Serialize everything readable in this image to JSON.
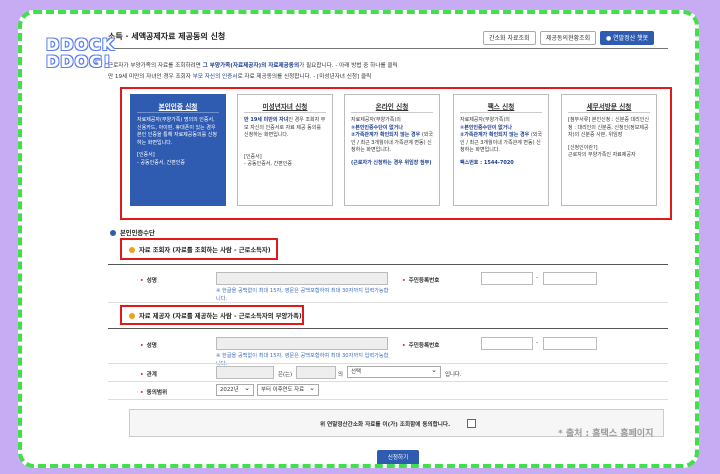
{
  "header": {
    "title": "소득 · 세액공제자료 제공동의 신청",
    "buttons": [
      "간소화 자료조회",
      "제공동의현황조회",
      "연말정산 챗봇"
    ]
  },
  "logo": {
    "line1": "DDOCK",
    "line2": "DDOG!"
  },
  "desc": {
    "line1_a": "근로자가 부양가족의 자료를 조회하려면 ",
    "line1_b": "그 부양가족(자료제공자)의 자료제공동의",
    "line1_c": "가 필요합니다. - 아래 방법 중 하나를 클릭",
    "line2_a": "만 19세 미만의 자녀인 경우 조회자 ",
    "line2_b": "부모 자신의 인증서",
    "line2_c": "로 자료 제공동의를 신청합니다. - [미성년자녀 신청] 클릭"
  },
  "cards": [
    {
      "title": "본인인증 신청",
      "body": "자료제공자(부양가족) 명의의 인증서, 신용카드, 아이핀, 휴대폰이 있는 경우 본인 인증을 통해 자료제공동의를 신청하는 화면입니다.",
      "tag": "[인증서]",
      "tag2": "- 공동인증서, 간편인증"
    },
    {
      "title": "미성년자녀 신청",
      "body_em": "만 19세 미만의 자녀",
      "body": "인 경우 조회자 부모 자신의 인증서로 자료 제공 동의를 신청하는 화면입니다.",
      "tag": "[인증서]",
      "tag2": "- 공동인증서, 간편인증"
    },
    {
      "title": "온라인 신청",
      "body": "자료제공자(부양가족)의",
      "em1": "①본인인증수단이 없거나",
      "em2": "②가족관계가 확인되지 않는 경우",
      "body2": "(외국인 / 최근 3개월이내 가족관계 변동) 신청하는 화면입니다.",
      "tag": "(근로자가 신청하는 경우 위임장 첨부)"
    },
    {
      "title": "팩스 신청",
      "body": "자료제공자(부양가족)의",
      "em1": "①본인인증수단이 없거나",
      "em2": "②가족관계가 확인되지 않는 경우",
      "body2": "(외국인 / 최근 3개월이내 가족관계 변동) 신청하는 화면입니다.",
      "tag": "팩스번호 : 1544-7020"
    },
    {
      "title": "세무서방문 신청",
      "body": "[첨부서류] 본인신청 : 신분증 대리인신청 : 대리인의 신분증, 신청인(정보제공자)의 신분증 사본, 위임장",
      "tag": "[신청인이란?]",
      "tag2": "근로자의 부양가족인 자료제공자"
    }
  ],
  "auth": {
    "label": "본인인증수단"
  },
  "viewer": {
    "section": "자료 조회자 (자료를 조회하는 사람 - 근로소득자)",
    "name_label": "성명",
    "rrn_label": "주민등록번호",
    "hint": "※ 한글을 공백없이 최대 15자, 영문은 공백포함하여 최대 30자까지 입력가능합니다."
  },
  "provider": {
    "section": "자료 제공자 (자료를 제공하는 사람 - 근로소득자의 부양가족)",
    "name_label": "성명",
    "rrn_label": "주민등록번호",
    "hint": "※ 한글을 공백없이 최대 15자, 영문은 공백포함하여 최대 30자까지 입력가능합니다.",
    "relation_label": "관계",
    "relation_mid": "은(는)",
    "relation_of": "의",
    "relation_select": "선택",
    "relation_end": "입니다.",
    "range_label": "동의범위",
    "year_select": "2022년",
    "range_select": "부터 이후연도 자료"
  },
  "agree": {
    "text": "위 연말정산간소화 자료를 이(가) 조회함에 동의합니다."
  },
  "submit": {
    "label": "신청하기"
  },
  "watermark": "* 출처 : 홈택스 홈페이지",
  "colors": {
    "accent": "#2f5bb0",
    "highlight": "#e01a1a",
    "border": "#3fe04a",
    "background": "#c8acf3"
  }
}
